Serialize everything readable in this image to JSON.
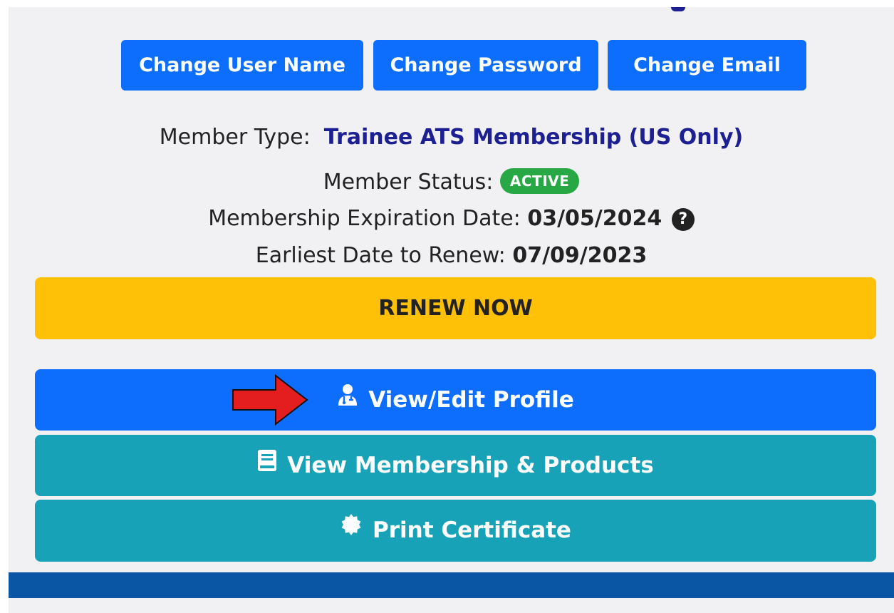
{
  "account_actions": {
    "change_user_name": "Change User Name",
    "change_password": "Change Password",
    "change_email": "Change Email"
  },
  "membership": {
    "type_label": "Member Type:",
    "type_value": "Trainee ATS Membership (US Only)",
    "status_label": "Member Status:",
    "status_value": "ACTIVE",
    "expiration_label": "Membership Expiration Date:",
    "expiration_value": "03/05/2024",
    "renew_label": "Earliest Date to Renew:",
    "renew_value": "07/09/2023"
  },
  "actions": {
    "renew_now": "RENEW NOW",
    "view_edit_profile": "View/Edit Profile",
    "view_membership_products": "View Membership & Products",
    "print_certificate": "Print Certificate"
  },
  "icons": {
    "help": "question-circle-icon",
    "profile": "user-doctor-icon",
    "membership": "book-icon",
    "certificate": "certificate-icon",
    "annotation": "red-arrow-icon"
  },
  "colors": {
    "primary": "#0d6efd",
    "info": "#17a2b8",
    "warning": "#ffc107",
    "success": "#27a844",
    "member_type": "#1c2093",
    "footer": "#0a56a5",
    "arrow": "#e41e1e"
  }
}
